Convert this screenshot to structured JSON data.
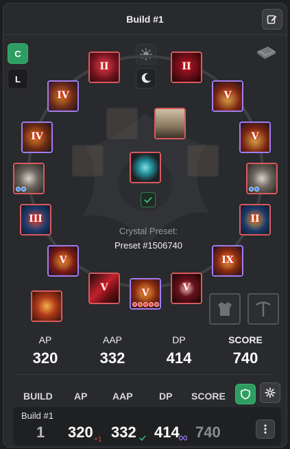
{
  "header": {
    "title": "Build #1"
  },
  "mode_buttons": {
    "c_label": "C",
    "l_label": "L"
  },
  "icons": {
    "edit": "edit-icon",
    "sun": "sun-icon",
    "moon": "moon-icon",
    "paper": "paper-icon",
    "check": "check-icon",
    "armor": "armor-icon",
    "pickaxe": "pickaxe-icon",
    "shield": "shield-icon",
    "gear": "gear-icon",
    "kebab": "kebab-menu-icon"
  },
  "slots": [
    {
      "slot": "helmet",
      "tier": "II",
      "rarity": "red"
    },
    {
      "slot": "chest",
      "tier": "II",
      "rarity": "red"
    },
    {
      "slot": "necklace",
      "tier": "IV",
      "rarity": "purple"
    },
    {
      "slot": "ring-right-top",
      "tier": "V",
      "rarity": "purple"
    },
    {
      "slot": "earring-left",
      "tier": "IV",
      "rarity": "purple"
    },
    {
      "slot": "ring-right",
      "tier": "V",
      "rarity": "purple"
    },
    {
      "slot": "belt-left",
      "tier": "",
      "rarity": "red"
    },
    {
      "slot": "belt-right",
      "tier": "",
      "rarity": "red"
    },
    {
      "slot": "gloves",
      "tier": "III",
      "rarity": "red"
    },
    {
      "slot": "boots",
      "tier": "II",
      "rarity": "red"
    },
    {
      "slot": "main-weapon",
      "tier": "V",
      "rarity": "purple"
    },
    {
      "slot": "sub-weapon",
      "tier": "IX",
      "rarity": "purple"
    },
    {
      "slot": "awakening",
      "tier": "V",
      "rarity": "red"
    },
    {
      "slot": "off-hand",
      "tier": "V",
      "rarity": "purple"
    },
    {
      "slot": "artifact",
      "tier": "V",
      "rarity": "red"
    },
    {
      "slot": "crystal",
      "tier": "",
      "rarity": "red"
    },
    {
      "slot": "alchemy-stone",
      "tier": "",
      "rarity": "red"
    }
  ],
  "crystal": {
    "label": "Crystal Preset:",
    "name": "Preset #1506740"
  },
  "stats": {
    "ap_label": "AP",
    "ap": "320",
    "aap_label": "AAP",
    "aap": "332",
    "dp_label": "DP",
    "dp": "414",
    "score_label": "SCORE",
    "score": "740"
  },
  "table": {
    "headers": {
      "build": "BUILD",
      "ap": "AP",
      "aap": "AAP",
      "dp": "DP",
      "score": "SCORE"
    },
    "row": {
      "name": "Build #1",
      "build": "1",
      "ap": "320",
      "ap_delta": "+1",
      "aap": "332",
      "dp": "414",
      "score": "740"
    }
  },
  "colors": {
    "accent": "#2f9d62",
    "red_rarity": "#d95a5e",
    "purple_rarity": "#9f7ef0"
  }
}
